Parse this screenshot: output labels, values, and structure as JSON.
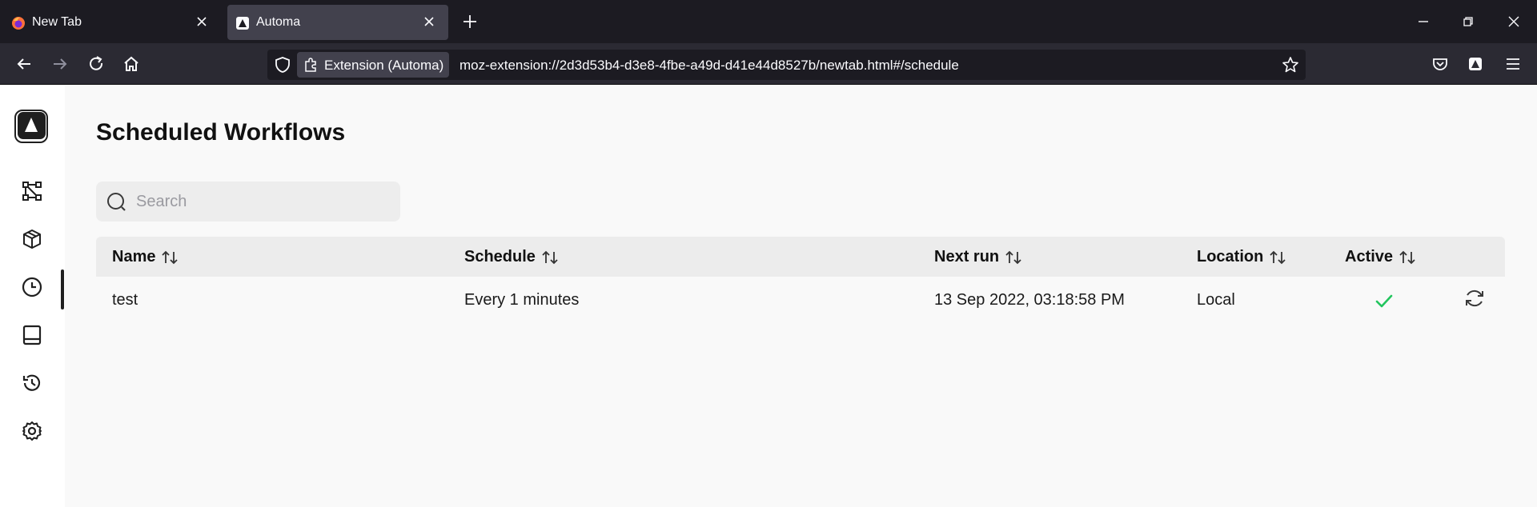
{
  "browser": {
    "tabs": [
      {
        "title": "New Tab",
        "active": false,
        "favicon": "firefox-icon"
      },
      {
        "title": "Automa",
        "active": true,
        "favicon": "automa-icon"
      }
    ],
    "url_bar": {
      "extension_label": "Extension (Automa)",
      "url": "moz-extension://2d3d53b4-d3e8-4fbe-a49d-d41e44d8527b/newtab.html#/schedule"
    }
  },
  "sidebar": {
    "items": [
      {
        "name": "workflows",
        "icon": "workflow-icon",
        "active": false
      },
      {
        "name": "packages",
        "icon": "package-icon",
        "active": false
      },
      {
        "name": "schedule",
        "icon": "clock-icon",
        "active": true
      },
      {
        "name": "storage",
        "icon": "storage-icon",
        "active": false
      },
      {
        "name": "logs",
        "icon": "history-icon",
        "active": false
      },
      {
        "name": "settings",
        "icon": "gear-icon",
        "active": false
      }
    ]
  },
  "page": {
    "title": "Scheduled Workflows",
    "search": {
      "placeholder": "Search",
      "value": ""
    }
  },
  "table": {
    "columns": [
      "Name",
      "Schedule",
      "Next run",
      "Location",
      "Active"
    ],
    "rows": [
      {
        "name": "test",
        "schedule": "Every 1 minutes",
        "next_run": "13 Sep 2022, 03:18:58 PM",
        "location": "Local",
        "active": true
      }
    ]
  },
  "colors": {
    "active_check": "#22c55e",
    "tab_bar": "#1c1b22",
    "nav_bar": "#2b2a33"
  }
}
